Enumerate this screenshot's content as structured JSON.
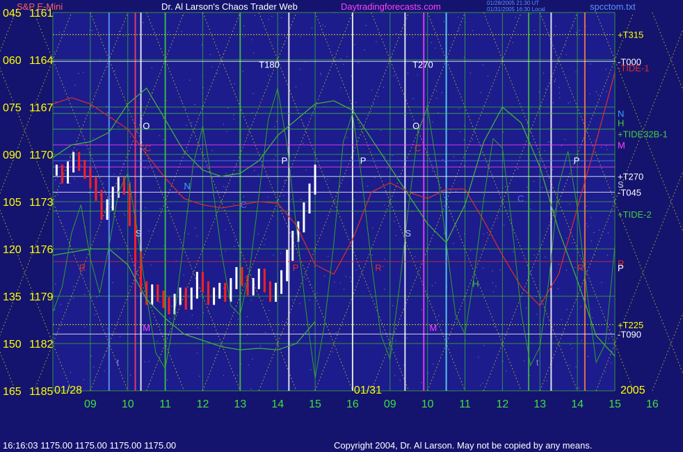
{
  "header": {
    "symbol": "S&P E-Mini",
    "title": "Dr. Al Larson's Chaos Trader Web",
    "website": "Daytradingforecasts.com",
    "timestamp_1": "01/28/2005 21:30 UT",
    "timestamp_2": "01/31/2005 16:30 Local",
    "filename": "spcctom.txt"
  },
  "footer": {
    "status": "16:16:03  1175.00 1175.00 1175.00 1175.00",
    "copyright": "Copyright 2004, Dr. Al Larson. May not be copied by any means."
  },
  "colors": {
    "background": "#14146e",
    "plot_area": "#1c1c8c",
    "yellow": "#ffff00",
    "green_grid": "#38b838",
    "price_bar_up": "#ffffff",
    "price_bar_down": "#ff2020",
    "tide_red": "#d03030",
    "tide_green": "#40b040",
    "website_magenta": "#ff40ff"
  },
  "chart_data": {
    "type": "line",
    "y_axis_left_labels": [
      {
        "cycle": "165",
        "price": "1185"
      },
      {
        "cycle": "150",
        "price": "1182"
      },
      {
        "cycle": "135",
        "price": "1179"
      },
      {
        "cycle": "120",
        "price": "1176"
      },
      {
        "cycle": "105",
        "price": "1173"
      },
      {
        "cycle": "090",
        "price": "1170"
      },
      {
        "cycle": "075",
        "price": "1167"
      },
      {
        "cycle": "060",
        "price": "1164"
      },
      {
        "cycle": "045",
        "price": "1161"
      }
    ],
    "ylim": [
      1161,
      1185
    ],
    "x_ticks": [
      "09",
      "10",
      "11",
      "12",
      "13",
      "14",
      "15",
      "16",
      "09",
      "10",
      "11",
      "12",
      "13",
      "14",
      "15",
      "16"
    ],
    "day_labels": [
      "01/28",
      "01/31"
    ],
    "year_label": "2005",
    "right_labels": [
      {
        "text": "+T315",
        "price": 1183.6,
        "color": "#ffff00"
      },
      {
        "text": "-T000",
        "price": 1181.9,
        "color": "#ffffff"
      },
      {
        "text": "-TIDE-1",
        "price": 1181.5,
        "color": "#e03030"
      },
      {
        "text": "H",
        "price": 1178.0,
        "color": "#40d040"
      },
      {
        "text": "N",
        "price": 1178.6,
        "color": "#40a0ff"
      },
      {
        "text": "+TIDE32B-1",
        "price": 1177.3,
        "color": "#40d040"
      },
      {
        "text": "M",
        "price": 1176.6,
        "color": "#ff40ff"
      },
      {
        "text": "+T270",
        "price": 1174.6,
        "color": "#ffffff"
      },
      {
        "text": "S",
        "price": 1174.1,
        "color": "#c0c0ff"
      },
      {
        "text": "-T045",
        "price": 1173.6,
        "color": "#ffffff"
      },
      {
        "text": "+TIDE-2",
        "price": 1172.2,
        "color": "#40d040"
      },
      {
        "text": "R",
        "price": 1169.1,
        "color": "#e03030"
      },
      {
        "text": "P",
        "price": 1168.8,
        "color": "#ffffff"
      },
      {
        "text": "+T225",
        "price": 1165.2,
        "color": "#ffff00"
      },
      {
        "text": "-T090",
        "price": 1164.6,
        "color": "#ffffff"
      }
    ],
    "in_chart_labels": [
      {
        "text": "T180",
        "color": "#ffffff"
      },
      {
        "text": "T270",
        "color": "#ffffff"
      }
    ],
    "series": [
      {
        "kind": "price_bars",
        "x": [
          0.1,
          0.25,
          0.4,
          0.55,
          0.7,
          0.85,
          1.0,
          1.15,
          1.3,
          1.45,
          1.6,
          1.75,
          1.9,
          2.05,
          2.2,
          2.35,
          2.5,
          2.65,
          2.8,
          2.95,
          3.1,
          3.25,
          3.4,
          3.55,
          3.7,
          3.85,
          4.0,
          4.15,
          4.3,
          4.45,
          4.6,
          4.75,
          4.9,
          5.05,
          5.2,
          5.35,
          5.5,
          5.65,
          5.8,
          5.95,
          6.1,
          6.25,
          6.4,
          6.55,
          6.7,
          6.85,
          7.0
        ],
        "y": [
          1175.0,
          1174.5,
          1175.2,
          1175.8,
          1175.3,
          1174.8,
          1174.2,
          1173.4,
          1172.2,
          1172.8,
          1173.6,
          1174.2,
          1173.8,
          1171.8,
          1169.5,
          1167.6,
          1166.8,
          1167.4,
          1167.0,
          1166.6,
          1166.2,
          1166.8,
          1167.2,
          1166.5,
          1167.2,
          1168.2,
          1167.6,
          1166.8,
          1167.2,
          1167.5,
          1167.0,
          1167.8,
          1168.5,
          1168.0,
          1167.4,
          1167.8,
          1168.4,
          1167.6,
          1167.0,
          1167.5,
          1168.3,
          1169.6,
          1170.8,
          1171.4,
          1172.6,
          1173.8,
          1175.0
        ]
      },
      {
        "kind": "tide_red",
        "x": [
          0,
          0.5,
          1.0,
          1.5,
          2.0,
          2.5,
          3.0,
          3.5,
          4.0,
          4.5,
          5.0,
          5.5,
          6.0,
          6.5,
          7.0,
          7.5,
          8.0,
          8.5,
          9.0,
          9.5,
          10.0,
          10.5,
          11.0,
          11.5,
          12.0,
          12.5,
          13.0,
          13.5,
          14.0,
          14.5,
          15.0
        ],
        "y": [
          1179.2,
          1179.6,
          1179.2,
          1178.4,
          1177.6,
          1176.0,
          1174.5,
          1173.2,
          1172.8,
          1172.6,
          1172.8,
          1173.0,
          1172.9,
          1171.5,
          1169.0,
          1168.4,
          1170.6,
          1173.6,
          1174.2,
          1173.6,
          1173.2,
          1173.8,
          1173.8,
          1171.8,
          1169.6,
          1167.6,
          1166.4,
          1168.4,
          1172.6,
          1176.8,
          1181.2
        ]
      },
      {
        "kind": "tide_green_smooth",
        "x": [
          0,
          0.5,
          1.0,
          1.5,
          2.0,
          2.5,
          3.0,
          3.5,
          4.0,
          4.5,
          5.0,
          5.5,
          6.0,
          6.5,
          7.0,
          7.5,
          8.0,
          8.5,
          9.0,
          9.5,
          10.0,
          10.5,
          11.0,
          11.5,
          12.0,
          12.5,
          13.0,
          13.5,
          14.0,
          14.5,
          15.0
        ],
        "y": [
          1175.8,
          1176.6,
          1176.8,
          1177.4,
          1179.2,
          1180.2,
          1178.2,
          1176.2,
          1175.0,
          1174.6,
          1174.8,
          1175.6,
          1177.2,
          1178.2,
          1179.2,
          1179.4,
          1178.8,
          1177.0,
          1175.2,
          1173.4,
          1171.6,
          1170.4,
          1172.8,
          1176.8,
          1179.0,
          1178.0,
          1175.2,
          1171.2,
          1168.0,
          1164.5,
          1163.2
        ]
      },
      {
        "kind": "tide_green_lower",
        "x": [
          0,
          0.5,
          1.0,
          1.5,
          2.0,
          2.5,
          3.0,
          3.5,
          4.0,
          4.5,
          5.0,
          5.5,
          6.0,
          6.5,
          7.0
        ],
        "y": [
          1169.6,
          1169.8,
          1170.0,
          1170.0,
          1169.0,
          1166.8,
          1165.6,
          1164.6,
          1164.2,
          1163.8,
          1163.6,
          1163.7,
          1163.6,
          1164.0,
          1165.4
        ]
      },
      {
        "kind": "tide_green_noisy",
        "x": [
          0,
          0.25,
          0.5,
          0.75,
          1.0,
          1.25,
          1.5,
          1.75,
          2.0,
          2.25,
          2.5,
          2.75,
          3.0,
          3.25,
          3.5,
          3.75,
          4.0,
          4.25,
          4.5,
          4.75,
          5.0,
          5.25,
          5.5,
          5.75,
          6.0,
          6.25,
          6.5,
          6.75,
          7.0,
          7.25,
          7.5,
          7.75,
          8.0,
          8.25,
          8.5,
          8.75,
          9.0,
          9.25,
          9.5,
          9.75,
          10.0,
          10.25,
          10.5,
          10.75,
          11.0,
          11.25,
          11.5,
          11.75,
          12.0,
          12.25,
          12.5,
          12.75,
          13.0,
          13.25,
          13.5,
          13.75,
          14.0,
          14.25,
          14.5,
          14.75,
          15.0
        ],
        "y": [
          1166.0,
          1167.6,
          1171.0,
          1172.8,
          1169.4,
          1167.2,
          1170.2,
          1173.6,
          1174.8,
          1171.2,
          1167.0,
          1163.4,
          1162.4,
          1165.8,
          1170.6,
          1175.4,
          1177.8,
          1174.2,
          1169.8,
          1166.4,
          1165.8,
          1168.6,
          1173.4,
          1178.2,
          1180.2,
          1176.6,
          1171.4,
          1166.2,
          1161.8,
          1165.2,
          1170.4,
          1176.8,
          1178.6,
          1174.4,
          1169.2,
          1164.6,
          1163.0,
          1167.6,
          1172.8,
          1177.4,
          1179.0,
          1175.2,
          1170.4,
          1165.8,
          1164.6,
          1168.4,
          1173.2,
          1177.0,
          1176.4,
          1171.6,
          1166.0,
          1162.6,
          1163.8,
          1168.2,
          1174.0,
          1176.2,
          1172.6,
          1167.4,
          1162.8,
          1164.0,
          1170.2
        ]
      }
    ],
    "horizontal_levels": [
      {
        "price": 1183.6,
        "style": "yellow-dotted"
      },
      {
        "price": 1181.9,
        "style": "white-solid"
      },
      {
        "price": 1178.6,
        "style": "green-solid"
      },
      {
        "price": 1177.6,
        "style": "green-solid"
      },
      {
        "price": 1176.6,
        "style": "magenta-solid"
      },
      {
        "price": 1175.6,
        "style": "blue-solid"
      },
      {
        "price": 1175.2,
        "style": "magenta-solid"
      },
      {
        "price": 1174.6,
        "style": "white-solid"
      },
      {
        "price": 1173.6,
        "style": "white-solid"
      },
      {
        "price": 1172.4,
        "style": "green-solid"
      },
      {
        "price": 1169.2,
        "style": "red-solid"
      },
      {
        "price": 1165.2,
        "style": "yellow-dotted"
      },
      {
        "price": 1164.6,
        "style": "white-solid"
      }
    ],
    "vertical_lines": [
      {
        "x": 1.5,
        "color": "#60a0ff"
      },
      {
        "x": 2.2,
        "color": "#ff4060"
      },
      {
        "x": 2.35,
        "color": "#ffffff"
      },
      {
        "x": 3.0,
        "color": "#40c040"
      },
      {
        "x": 5.0,
        "color": "#40c040"
      },
      {
        "x": 6.3,
        "color": "#ffffff"
      },
      {
        "x": 8.0,
        "color": "#ffffff"
      },
      {
        "x": 9.4,
        "color": "#ffffff"
      },
      {
        "x": 9.9,
        "color": "#ff40ff"
      },
      {
        "x": 10.5,
        "color": "#60e0ff"
      },
      {
        "x": 12.7,
        "color": "#40c040"
      },
      {
        "x": 13.3,
        "color": "#ffffff"
      },
      {
        "x": 14.2,
        "color": "#ff8040"
      }
    ],
    "letter_marks": [
      {
        "text": "O",
        "x": 2.4,
        "y": 1177.6,
        "color": "#ffffff"
      },
      {
        "text": "C",
        "x": 2.45,
        "y": 1176.2,
        "color": "#e03030"
      },
      {
        "text": "N",
        "x": 3.5,
        "y": 1173.8,
        "color": "#40a0ff"
      },
      {
        "text": "S",
        "x": 2.2,
        "y": 1170.8,
        "color": "#c0c0ff"
      },
      {
        "text": "R",
        "x": 0.7,
        "y": 1168.6,
        "color": "#e03030"
      },
      {
        "text": "M",
        "x": 2.4,
        "y": 1164.8,
        "color": "#ff40ff"
      },
      {
        "text": "t",
        "x": 1.7,
        "y": 1162.6,
        "color": "#8080ff"
      },
      {
        "text": "C",
        "x": 5.0,
        "y": 1172.6,
        "color": "#6060ff"
      },
      {
        "text": "P",
        "x": 6.1,
        "y": 1175.4,
        "color": "#ffffff"
      },
      {
        "text": "P",
        "x": 6.4,
        "y": 1168.6,
        "color": "#e03030"
      },
      {
        "text": "P",
        "x": 8.2,
        "y": 1175.4,
        "color": "#ffffff"
      },
      {
        "text": "R",
        "x": 8.6,
        "y": 1168.6,
        "color": "#e03030"
      },
      {
        "text": "O",
        "x": 9.6,
        "y": 1177.6,
        "color": "#ffffff"
      },
      {
        "text": "C",
        "x": 9.65,
        "y": 1176.2,
        "color": "#e03030"
      },
      {
        "text": "S",
        "x": 9.4,
        "y": 1170.8,
        "color": "#c0c0ff"
      },
      {
        "text": "M",
        "x": 10.05,
        "y": 1164.8,
        "color": "#ff40ff"
      },
      {
        "text": "H",
        "x": 11.2,
        "y": 1167.6,
        "color": "#40c040"
      },
      {
        "text": "t",
        "x": 12.9,
        "y": 1162.6,
        "color": "#8080ff"
      },
      {
        "text": "C",
        "x": 12.4,
        "y": 1173.0,
        "color": "#6060ff"
      },
      {
        "text": "P",
        "x": 13.9,
        "y": 1175.4,
        "color": "#ffffff"
      },
      {
        "text": "R",
        "x": 14.0,
        "y": 1168.6,
        "color": "#e03030"
      }
    ]
  }
}
